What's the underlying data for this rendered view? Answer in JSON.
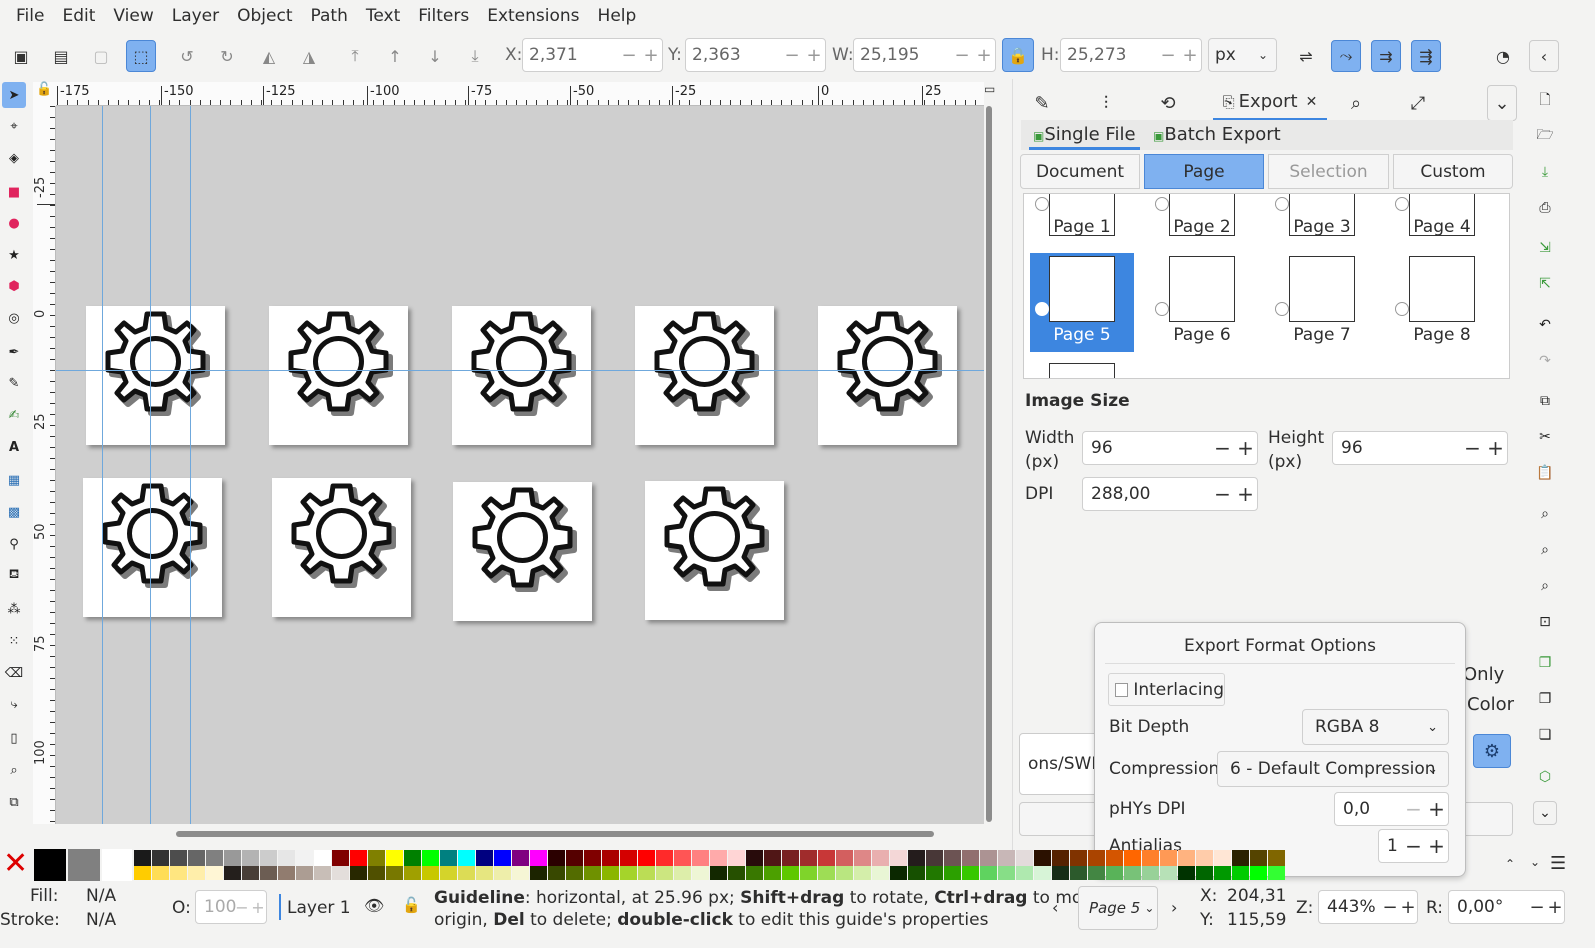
{
  "menu": [
    "File",
    "Edit",
    "View",
    "Layer",
    "Object",
    "Path",
    "Text",
    "Filters",
    "Extensions",
    "Help"
  ],
  "toolbar": {
    "x_label": "X:",
    "x_value": "2,371",
    "y_label": "Y:",
    "y_value": "2,363",
    "w_label": "W:",
    "w_value": "25,195",
    "h_label": "H:",
    "h_value": "25,273",
    "unit": "px"
  },
  "ruler_top": [
    "-175",
    "-150",
    "-125",
    "-100",
    "-75",
    "-50",
    "-25",
    "0",
    "25"
  ],
  "ruler_left": [
    "-25",
    "0",
    "25",
    "50",
    "75",
    "100"
  ],
  "dock": {
    "export_tab": "Export",
    "single_file": "Single File",
    "batch_export": "Batch Export",
    "modes": [
      "Document",
      "Page",
      "Selection",
      "Custom"
    ],
    "pages": [
      "Page 1",
      "Page 2",
      "Page 3",
      "Page 4",
      "Page 5",
      "Page 6",
      "Page 7",
      "Page 8"
    ],
    "image_size_heading": "Image Size",
    "width_label": "Width\n(px)",
    "width_label_1": "Width",
    "width_label_2": "(px)",
    "width_value": "96",
    "height_label_1": "Height",
    "height_label_2": "(px)",
    "height_value": "96",
    "dpi_label": "DPI",
    "dpi_value": "288,00",
    "only_text": "Only",
    "color_text": "Color",
    "filename_fragment": "ons/SWH"
  },
  "popover": {
    "title": "Export Format Options",
    "interlacing": "Interlacing",
    "bit_depth_label": "Bit Depth",
    "bit_depth_value": "RGBA 8",
    "compression_label": "Compression",
    "compression_value": "6 - Default Compression",
    "phys_label": "pHYs DPI",
    "phys_value": "0,0",
    "antialias_label": "Antialias",
    "antialias_value": "1"
  },
  "status": {
    "fill_label": "Fill:",
    "fill_value": "N/A",
    "stroke_label": "Stroke:",
    "stroke_value": "N/A",
    "opacity_label": "O:",
    "opacity_value": "100",
    "layer": "Layer 1",
    "message_line1_b1": "Guideline",
    "message_line1_t1": ": horizontal, at 25.96 px; ",
    "message_line1_b2": "Shift+drag",
    "message_line1_t2": " to rotate, ",
    "message_line1_b3": "Ctrl+drag",
    "message_line1_t3": " to move",
    "message_line2_t1": "origin, ",
    "message_line2_b1": "Del",
    "message_line2_t2": " to delete; ",
    "message_line2_b2": "double-click",
    "message_line2_t3": " to edit this guide's properties",
    "page_selector": "Page 5",
    "cx_label": "X:",
    "cx_value": "204,31",
    "cy_label": "Y:",
    "cy_value": "115,59",
    "zoom_label": "Z:",
    "zoom_value": "443%",
    "rotate_label": "R:",
    "rotate_value": "0,00°"
  },
  "colors": {
    "accent": "#3d86e0",
    "selected_tab": "#7fb1f0",
    "guide": "#6fa8dc",
    "canvas": "#cfcfcf"
  }
}
